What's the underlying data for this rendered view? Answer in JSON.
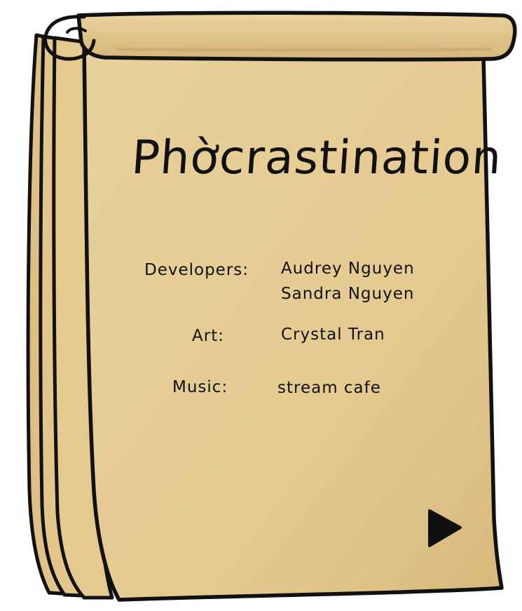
{
  "screen": {
    "title": "Phờcrastination",
    "credits": {
      "developers_label": "Developers:",
      "developers": [
        "Audrey Nguyen",
        "Sandra Nguyen"
      ],
      "art_label": "Art:",
      "art": "Crystal Tran",
      "music_label": "Music:",
      "music": "stream cafe"
    },
    "next_icon": "play-triangle-icon"
  },
  "colors": {
    "paper": "#e6cc94",
    "paper_shadow": "#d9bb7e",
    "outline": "#111111",
    "highlight": "#e08a7d"
  }
}
